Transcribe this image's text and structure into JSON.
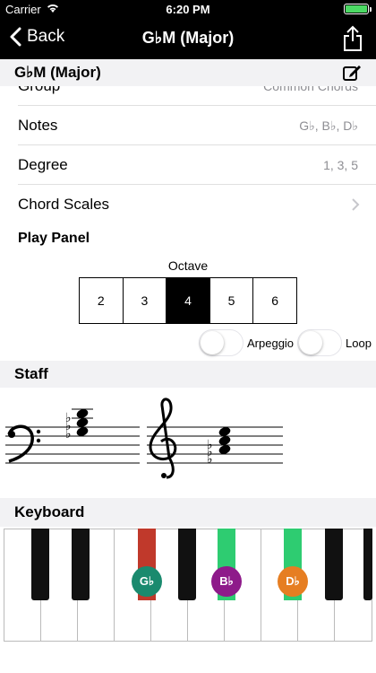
{
  "status": {
    "carrier": "Carrier",
    "time": "6:20 PM"
  },
  "nav": {
    "back_label": "Back",
    "title": "G♭M (Major)"
  },
  "header": {
    "title": "G♭M (Major)"
  },
  "rows": {
    "group": {
      "label": "Group",
      "value": "Common Chords"
    },
    "notes": {
      "label": "Notes",
      "value": "G♭, B♭, D♭"
    },
    "degree": {
      "label": "Degree",
      "value": "1, 3, 5"
    },
    "chord_scales": {
      "label": "Chord Scales"
    }
  },
  "play_panel": {
    "title": "Play Panel",
    "octave_label": "Octave",
    "octaves": [
      "2",
      "3",
      "4",
      "5",
      "6"
    ],
    "selected_octave": "4",
    "arpeggio_label": "Arpeggio",
    "arpeggio_on": false,
    "loop_label": "Loop",
    "loop_on": false
  },
  "staff": {
    "title": "Staff"
  },
  "keyboard": {
    "title": "Keyboard",
    "notes": [
      {
        "label": "G♭",
        "color": "#1a8a6e",
        "key_color": "#c0392b"
      },
      {
        "label": "B♭",
        "color": "#8e1a8a",
        "key_color": "#2ecc71"
      },
      {
        "label": "D♭",
        "color": "#e67e22",
        "key_color": "#2ecc71"
      }
    ]
  },
  "colors": {
    "bar": "#000000",
    "section_bg": "#f2f2f4",
    "battery": "#4cd964"
  }
}
